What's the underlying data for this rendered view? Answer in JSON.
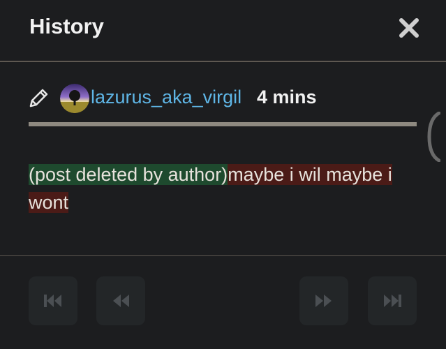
{
  "header": {
    "title": "History",
    "close_icon": "close-icon"
  },
  "revision": {
    "edit_icon": "pencil-icon",
    "username": "lazurus_aka_virgil",
    "time_ago": "4 mins"
  },
  "diff": {
    "inserted": "(post deleted by author)",
    "deleted_line1": "maybe i wil maybe i",
    "deleted_line2": "wont"
  },
  "nav": {
    "first_icon": "skip-to-first-icon",
    "prev_icon": "previous-icon",
    "next_icon": "next-icon",
    "last_icon": "skip-to-last-icon"
  },
  "colors": {
    "background": "#1c1d1f",
    "username": "#5fb6e6",
    "inserted_bg": "#1e4a2e",
    "deleted_bg": "#4b1b17"
  }
}
